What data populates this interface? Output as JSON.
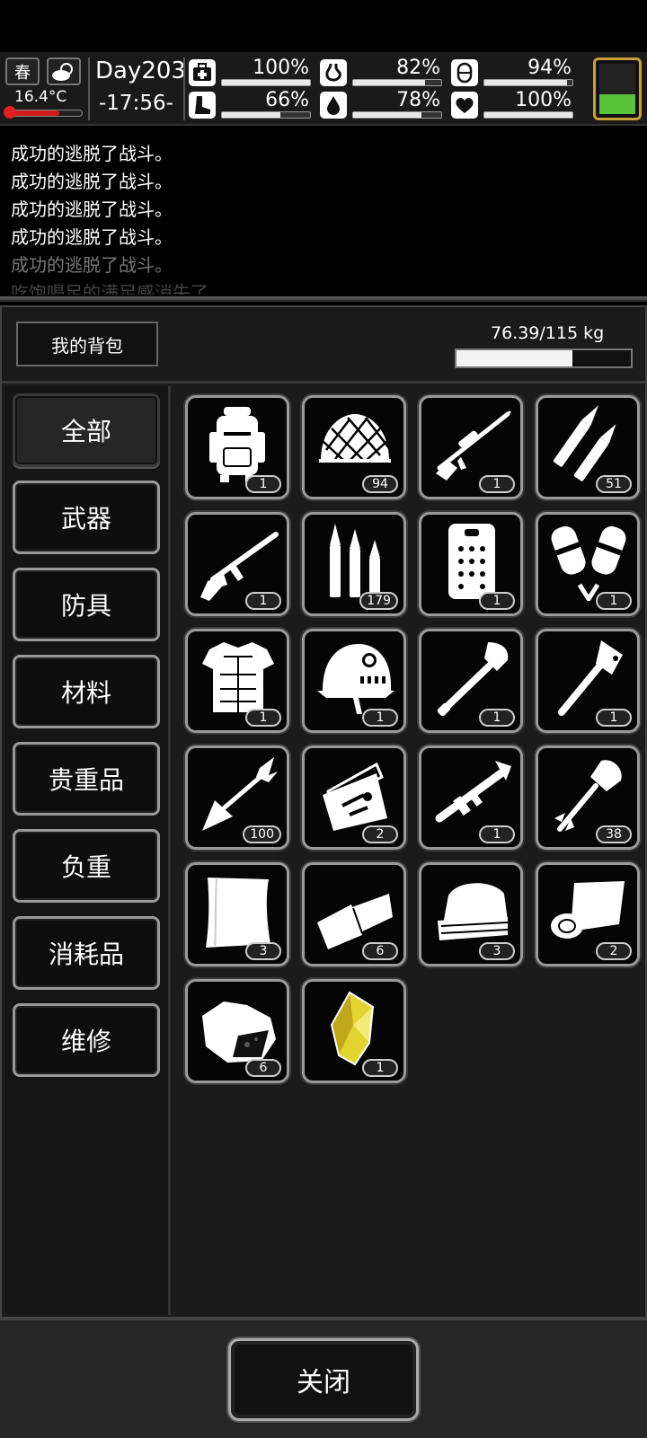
{
  "hud": {
    "season": "春",
    "weather_icon": "partly-cloudy-icon",
    "temperature": "16.4°C",
    "temperature_level": 0.7,
    "day": "Day203",
    "time": "-17:56-",
    "stats": [
      {
        "name": "health",
        "icon": "medkit-icon",
        "value": "100%",
        "level": 1.0
      },
      {
        "name": "hunger",
        "icon": "stomach-icon",
        "value": "82%",
        "level": 0.82
      },
      {
        "name": "stamina",
        "icon": "pill-icon",
        "value": "94%",
        "level": 0.94
      },
      {
        "name": "fatigue",
        "icon": "boot-icon",
        "value": "66%",
        "level": 0.66
      },
      {
        "name": "thirst",
        "icon": "water-drop-icon",
        "value": "78%",
        "level": 0.78
      },
      {
        "name": "mood",
        "icon": "heart-icon",
        "value": "100%",
        "level": 1.0
      }
    ],
    "battery_level": 0.4,
    "battery_color": "#59c43b"
  },
  "log": [
    "成功的逃脱了战斗。",
    "成功的逃脱了战斗。",
    "成功的逃脱了战斗。",
    "成功的逃脱了战斗。",
    "成功的逃脱了战斗。",
    "吃饱喝足的满足感消失了"
  ],
  "inventory": {
    "title": "我的背包",
    "weight": "76.39/115 kg",
    "weight_fraction": 0.664,
    "categories": [
      "全部",
      "武器",
      "防具",
      "材料",
      "贵重品",
      "负重",
      "消耗品",
      "维修"
    ],
    "active_category": 0,
    "items": [
      {
        "icon": "backpack-icon",
        "qty": "1"
      },
      {
        "icon": "camo-net-helmet-icon",
        "qty": "94"
      },
      {
        "icon": "sniper-rifle-icon",
        "qty": "1"
      },
      {
        "icon": "rifle-bullets-icon",
        "qty": "51"
      },
      {
        "icon": "assault-rifle-icon",
        "qty": "1"
      },
      {
        "icon": "ammo-cartridges-icon",
        "qty": "179"
      },
      {
        "icon": "riot-shield-icon",
        "qty": "1"
      },
      {
        "icon": "knee-pads-icon",
        "qty": "1"
      },
      {
        "icon": "body-armor-icon",
        "qty": "1"
      },
      {
        "icon": "army-helmet-icon",
        "qty": "1"
      },
      {
        "icon": "shovel-icon",
        "qty": "1"
      },
      {
        "icon": "axe-icon",
        "qty": "1"
      },
      {
        "icon": "arrow-icon",
        "qty": "100"
      },
      {
        "icon": "toolbox-icon",
        "qty": "2"
      },
      {
        "icon": "rocket-launcher-icon",
        "qty": "1"
      },
      {
        "icon": "rocket-grenade-icon",
        "qty": "38"
      },
      {
        "icon": "cloth-sheet-icon",
        "qty": "3"
      },
      {
        "icon": "bandage-cloth-icon",
        "qty": "6"
      },
      {
        "icon": "folded-towel-icon",
        "qty": "3"
      },
      {
        "icon": "rolled-fabric-icon",
        "qty": "2"
      },
      {
        "icon": "rock-ore-icon",
        "qty": "6"
      },
      {
        "icon": "gold-ore-icon",
        "qty": "1"
      }
    ]
  },
  "footer": {
    "close_label": "关闭"
  }
}
